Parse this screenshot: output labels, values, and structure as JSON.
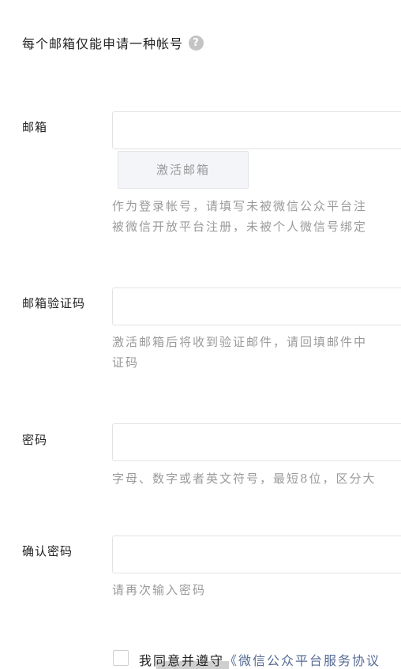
{
  "notice": {
    "text": "每个邮箱仅能申请一种帐号",
    "help_glyph": "?",
    "help_icon_color": "#c4c4c4"
  },
  "email": {
    "label": "邮箱",
    "value": "",
    "activate_button": "激活邮箱",
    "tip_line1": "作为登录帐号，请填写未被微信公众平台注",
    "tip_line2": "被微信开放平台注册，未被个人微信号绑定"
  },
  "verify_code": {
    "label": "邮箱验证码",
    "value": "",
    "tip_line1": "激活邮箱后将收到验证邮件，请回填邮件中",
    "tip_line2": "证码"
  },
  "password": {
    "label": "密码",
    "value": "",
    "tip": "字母、数字或者英文符号，最短8位，区分大"
  },
  "confirm_password": {
    "label": "确认密码",
    "value": "",
    "tip": "请再次输入密码"
  },
  "agreement": {
    "checked": false,
    "prefix": "我同意并遵守",
    "link": "《微信公众平台服务协议",
    "link_color": "#576b95"
  }
}
